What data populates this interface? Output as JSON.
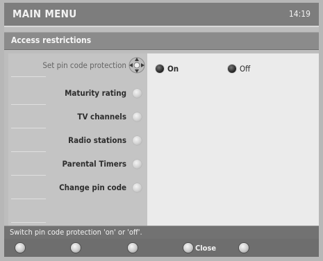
{
  "header": {
    "title": "MAIN MENU",
    "clock": "14:19"
  },
  "section": {
    "title": "Access restrictions"
  },
  "menu": [
    {
      "label": "Set pin code protection",
      "selected": true
    },
    {
      "label": "Maturity rating"
    },
    {
      "label": "TV channels"
    },
    {
      "label": "Radio stations"
    },
    {
      "label": "Parental Timers"
    },
    {
      "label": "Change pin code"
    }
  ],
  "options": [
    {
      "label": "On",
      "selected": true
    },
    {
      "label": "Off",
      "selected": false
    }
  ],
  "status": {
    "text": "Switch pin code protection 'on' or 'off'."
  },
  "footer": {
    "keys": [
      {
        "label": ""
      },
      {
        "label": ""
      },
      {
        "label": ""
      },
      {
        "label": "Close"
      },
      {
        "label": ""
      }
    ]
  }
}
